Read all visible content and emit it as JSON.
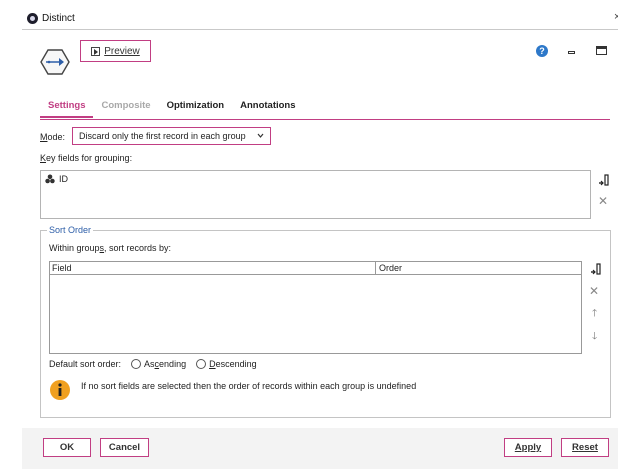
{
  "window": {
    "title": "Distinct",
    "close_glyph": "×"
  },
  "header": {
    "node_icon": "distinct-node-icon",
    "preview_label": "Preview",
    "help_glyph": "?"
  },
  "tabs": [
    {
      "label": "Settings",
      "state": "active"
    },
    {
      "label": "Composite",
      "state": "disabled"
    },
    {
      "label": "Optimization",
      "state": "normal"
    },
    {
      "label": "Annotations",
      "state": "normal"
    }
  ],
  "settings": {
    "mode_label_first": "M",
    "mode_label_rest": "ode:",
    "mode_value": "Discard only the first record in each group",
    "key_label_first": "K",
    "key_label_rest": "ey fields for grouping:",
    "key_fields": [
      {
        "name": "ID",
        "icon": "nominal-field-icon"
      }
    ],
    "sort_order": {
      "legend": "Sort Order",
      "within_pre": "Within group",
      "within_u": "s",
      "within_post": ", sort records by:",
      "columns": [
        "Field",
        "Order"
      ],
      "rows": [],
      "default_label": "Default sort order:",
      "options": [
        {
          "pre": "As",
          "u": "c",
          "post": "ending"
        },
        {
          "pre": "",
          "u": "D",
          "post": "escending"
        }
      ],
      "info_text": "If no sort fields are selected then the order of records within each group is undefined"
    }
  },
  "footer": {
    "ok": "OK",
    "cancel": "Cancel",
    "apply_first": "A",
    "apply_rest": "pply",
    "reset_first": "R",
    "reset_rest": "eset"
  },
  "colors": {
    "accent": "#c13e83",
    "legend": "#2d5ea8",
    "help": "#2d78c9",
    "info": "#f0a020"
  }
}
